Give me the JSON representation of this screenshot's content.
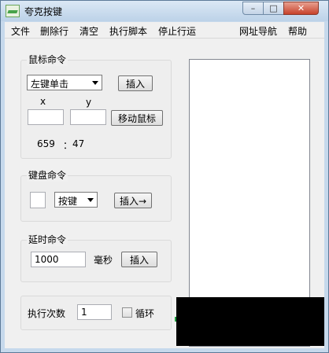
{
  "window": {
    "title": "夸克按键"
  },
  "titlebar_buttons": {
    "minimize": "–",
    "maximize": "□",
    "close": "✕"
  },
  "menu": {
    "items": [
      "文件",
      "删除行",
      "清空",
      "执行脚本",
      "停止行运"
    ],
    "right_items": [
      "网址导航",
      "帮助"
    ]
  },
  "mouse_group": {
    "title": "鼠标命令",
    "action_select": "左键单击",
    "insert_button": "插入",
    "x_label": "x",
    "y_label": "y",
    "x_value": "",
    "y_value": "",
    "move_button": "移动鼠标",
    "coord_x": "659",
    "coord_sep": "：",
    "coord_y": "47"
  },
  "keyboard_group": {
    "title": "键盘命令",
    "key_value": "",
    "key_select": "按键",
    "insert_button": "插入→"
  },
  "delay_group": {
    "title": "延时命令",
    "delay_value": "1000",
    "unit": "毫秒",
    "insert_button": "插入"
  },
  "exec_group": {
    "label": "执行次数",
    "count_value": "1",
    "loop_label": "循环",
    "loop_checked": false
  }
}
